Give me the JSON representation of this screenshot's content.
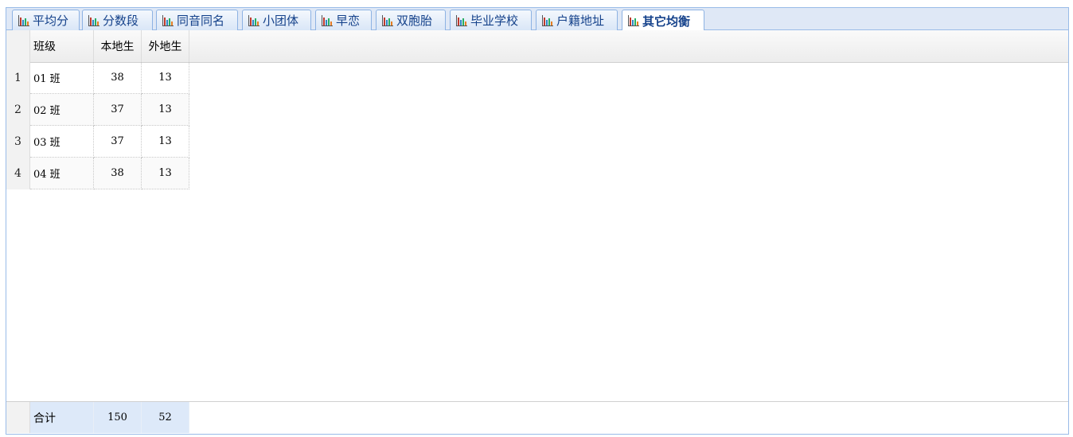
{
  "tabs": [
    {
      "label": "平均分",
      "icon": "bar-chart-icon"
    },
    {
      "label": "分数段",
      "icon": "bar-chart-icon"
    },
    {
      "label": "同音同名",
      "icon": "bar-chart-icon"
    },
    {
      "label": "小团体",
      "icon": "bar-chart-icon"
    },
    {
      "label": "早恋",
      "icon": "bar-chart-icon"
    },
    {
      "label": "双胞胎",
      "icon": "bar-chart-icon"
    },
    {
      "label": "毕业学校",
      "icon": "bar-chart-icon"
    },
    {
      "label": "户籍地址",
      "icon": "bar-chart-icon"
    },
    {
      "label": "其它均衡",
      "icon": "bar-chart-icon",
      "active": true
    }
  ],
  "table": {
    "columns": [
      "班级",
      "本地生",
      "外地生"
    ],
    "rows": [
      {
        "num": "1",
        "class": "01 班",
        "local": "38",
        "nonlocal": "13"
      },
      {
        "num": "2",
        "class": "02 班",
        "local": "37",
        "nonlocal": "13"
      },
      {
        "num": "3",
        "class": "03 班",
        "local": "37",
        "nonlocal": "13"
      },
      {
        "num": "4",
        "class": "04 班",
        "local": "38",
        "nonlocal": "13"
      }
    ],
    "summary": {
      "label": "合计",
      "local": "150",
      "nonlocal": "52"
    }
  },
  "colors": {
    "accent": "#15428b",
    "border": "#99bbe8",
    "summary_bg": "#dde9f9"
  }
}
